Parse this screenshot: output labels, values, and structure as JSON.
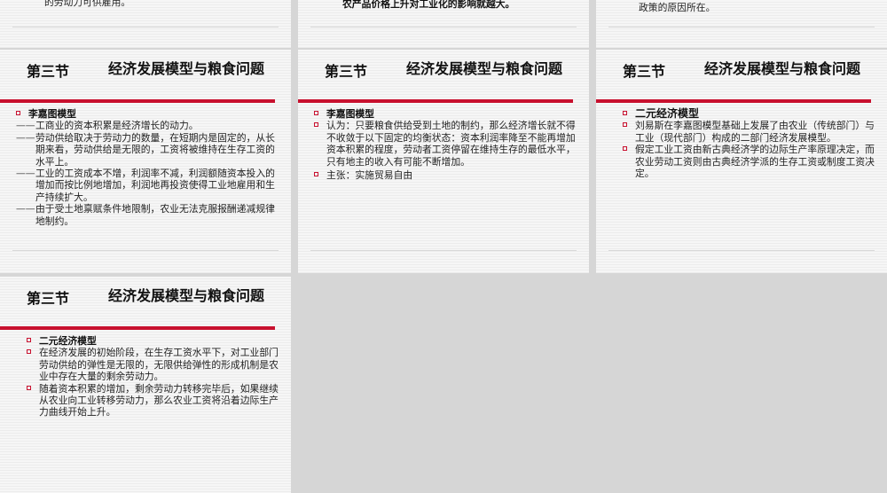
{
  "partials": {
    "left_text": "的劳动力可供雇用。",
    "mid_text": "农产品价格上升对工业化的影响就越大。",
    "right_line1": "…",
    "right_line2": "政策的原因所在。"
  },
  "slides": [
    {
      "section": "第三节",
      "title": "经济发展模型与粮食问题",
      "heading": "李嘉图模型",
      "items": [
        {
          "type": "dash",
          "text": "工商业的资本积累是经济增长的动力。"
        },
        {
          "type": "dash",
          "text": "劳动供给取决于劳动力的数量，在短期内是固定的，从长期来看，劳动供给是无限的，工资将被维持在生存工资的水平上。"
        },
        {
          "type": "dash",
          "text": "工业的工资成本不增，利润率不减，利润额随资本投入的增加而按比例地增加，利润地再投资使得工业地雇用和生产持续扩大。"
        },
        {
          "type": "dash",
          "text": "由于受土地禀赋条件地限制，农业无法克服报酬递减规律地制约。"
        }
      ]
    },
    {
      "section": "第三节",
      "title": "经济发展模型与粮食问题",
      "heading": "李嘉图模型",
      "items": [
        {
          "type": "bullet",
          "text": "认为：只要粮食供给受到土地的制约，那么经济增长就不得不收敛于以下固定的均衡状态：资本利润率降至不能再增加资本积累的程度，劳动者工资停留在维持生存的最低水平，只有地主的收入有可能不断增加。"
        },
        {
          "type": "bullet",
          "text": "主张：实施贸易自由"
        }
      ]
    },
    {
      "section": "第三节",
      "title": "经济发展模型与粮食问题",
      "heading": "二元经济模型",
      "items": [
        {
          "type": "bullet",
          "text": "刘易斯在李嘉图模型基础上发展了由农业（传统部门）与工业（现代部门）构成的二部门经济发展模型。"
        },
        {
          "type": "bullet",
          "text": "假定工业工资由新古典经济学的边际生产率原理决定，而农业劳动工资则由古典经济学派的生存工资或制度工资决定。"
        }
      ]
    },
    {
      "section": "第三节",
      "title": "经济发展模型与粮食问题",
      "heading": "二元经济模型",
      "items": [
        {
          "type": "bullet",
          "text": "在经济发展的初始阶段，在生存工资水平下，对工业部门劳动供给的弹性是无限的，无限供给弹性的形成机制是农业中存在大量的剩余劳动力。"
        },
        {
          "type": "bullet",
          "text": "随着资本积累的增加，剩余劳动力转移完毕后，如果继续从农业向工业转移劳动力，那么农业工资将沿着边际生产力曲线开始上升。"
        }
      ]
    }
  ]
}
